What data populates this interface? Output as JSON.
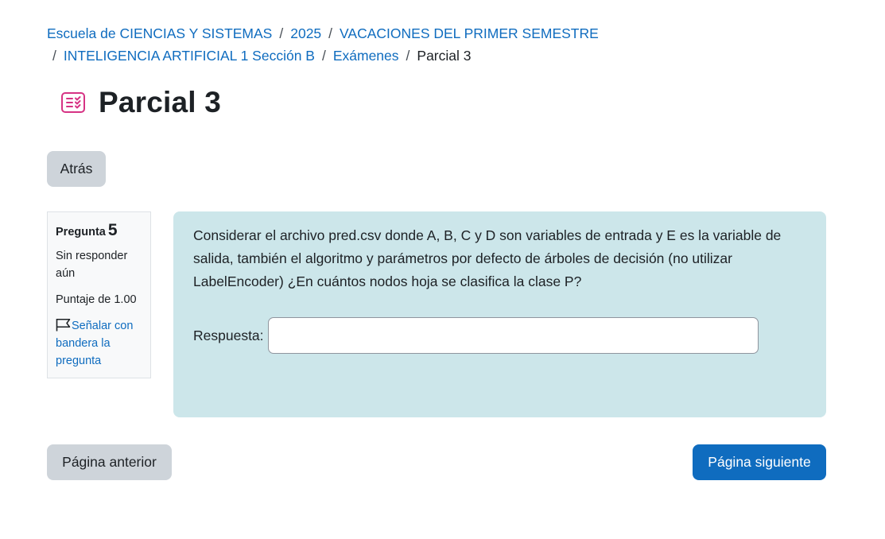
{
  "breadcrumb": {
    "items": [
      "Escuela de CIENCIAS Y SISTEMAS",
      "2025",
      "VACACIONES DEL PRIMER SEMESTRE",
      "INTELIGENCIA ARTIFICIAL 1 Sección B",
      "Exámenes",
      "Parcial 3"
    ],
    "separator": "/"
  },
  "page": {
    "title": "Parcial 3",
    "icon": "quiz-icon",
    "icon_color": "#d63384"
  },
  "buttons": {
    "back": "Atrás",
    "prev": "Página anterior",
    "next": "Página siguiente"
  },
  "question_info": {
    "label": "Pregunta",
    "number": "5",
    "state": "Sin responder aún",
    "grade": "Puntaje de 1.00",
    "flag": "Señalar con bandera la pregunta",
    "flag_icon": "flag-icon"
  },
  "question": {
    "text": "Considerar el archivo pred.csv donde A, B, C y D son variables de entrada y E es la variable de salida, también el algoritmo y parámetros por defecto de árboles de decisión (no utilizar LabelEncoder) ¿En cuántos nodos hoja se clasifica la clase P?",
    "answer_label": "Respuesta:",
    "answer_value": ""
  },
  "colors": {
    "link": "#0f6cbf",
    "primary": "#0f6cbf",
    "secondary": "#ced4da",
    "content_bg": "#cce6ea"
  }
}
